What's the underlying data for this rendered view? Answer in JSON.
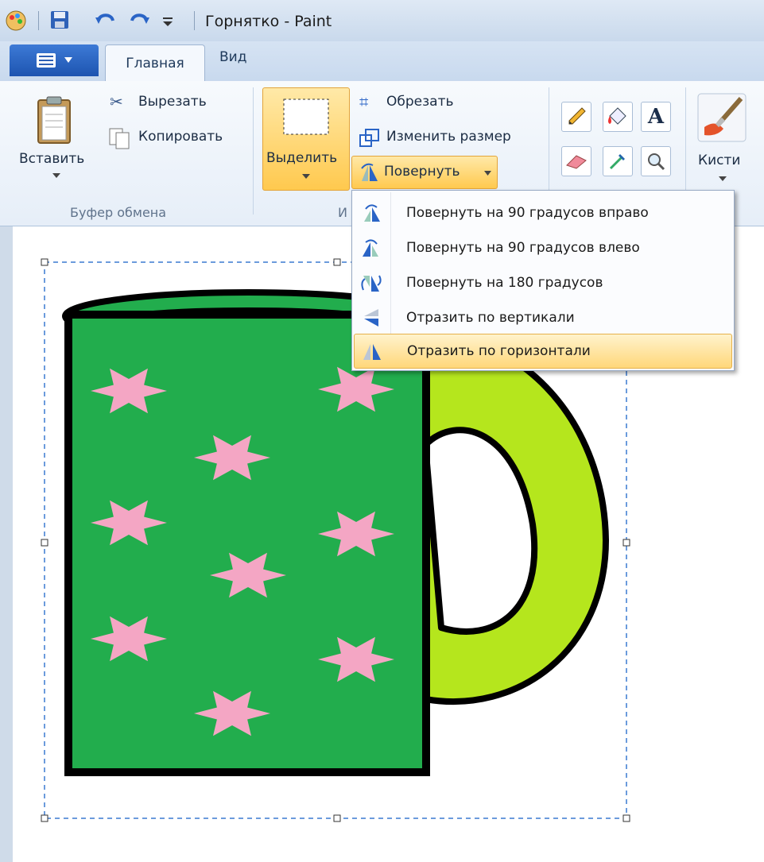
{
  "window": {
    "title": "Горнятко - Paint"
  },
  "quick_access": {
    "icons": [
      "paint-app-icon",
      "save-icon",
      "undo-icon",
      "redo-icon",
      "customize-icon"
    ]
  },
  "tabs": {
    "home": "Главная",
    "view": "Вид"
  },
  "clipboard": {
    "paste": "Вставить",
    "cut": "Вырезать",
    "copy": "Копировать",
    "group_label": "Буфер обмена"
  },
  "image_group": {
    "select": "Выделить",
    "crop": "Обрезать",
    "resize": "Изменить размер",
    "rotate": "Повернуть",
    "group_label": "И"
  },
  "brushes": {
    "label": "Кисти"
  },
  "rotate_menu": {
    "items": [
      {
        "label": "Повернуть на 90 градусов вправо",
        "highlighted": false
      },
      {
        "label": "Повернуть на 90 градусов влево",
        "highlighted": false
      },
      {
        "label": "Повернуть на 180 градусов",
        "highlighted": false
      },
      {
        "label": "Отразить по вертикали",
        "highlighted": false
      },
      {
        "label": "Отразить по горизонтали",
        "highlighted": true
      }
    ]
  },
  "colors": {
    "mug_body": "#22ad4d",
    "mug_handle": "#b5e61d",
    "tea": "#ed1c24",
    "stars": "#f4a6c4",
    "highlight": "#ffd77a"
  }
}
